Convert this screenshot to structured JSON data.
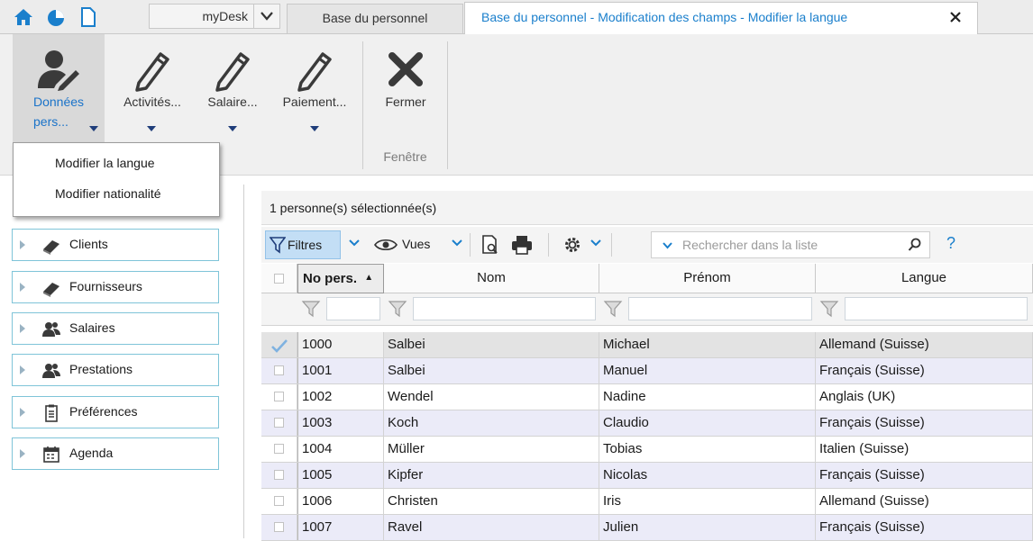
{
  "tabbar": {
    "mydesk": "myDesk",
    "tabs": [
      {
        "label": "Base du personnel"
      },
      {
        "label": "Base du personnel - Modification des champs - Modifier la langue"
      }
    ]
  },
  "ribbon": {
    "buttons": [
      {
        "label_line1": "Données",
        "label_line2": "pers...",
        "icon": "person-edit-icon"
      },
      {
        "label": "Activités...",
        "icon": "pencil-icon"
      },
      {
        "label": "Salaire...",
        "icon": "pencil-icon"
      },
      {
        "label": "Paiement...",
        "icon": "pencil-icon"
      },
      {
        "label": "Fermer",
        "icon": "close-x-icon"
      }
    ],
    "group_fenetre": "Fenêtre"
  },
  "dropdown": {
    "items": [
      "Modifier la langue",
      "Modifier nationalité"
    ]
  },
  "sidebar": {
    "items": [
      {
        "label": "Clients",
        "icon": "book-icon"
      },
      {
        "label": "Fournisseurs",
        "icon": "book-icon"
      },
      {
        "label": "Salaires",
        "icon": "people-icon"
      },
      {
        "label": "Prestations",
        "icon": "people-icon"
      },
      {
        "label": "Préférences",
        "icon": "clipboard-icon"
      },
      {
        "label": "Agenda",
        "icon": "calendar-icon"
      }
    ]
  },
  "main": {
    "selection_count": "1 personne(s) sélectionnée(s)",
    "toolbar": {
      "filtres": "Filtres",
      "vues": "Vues",
      "search_placeholder": "Rechercher dans la liste",
      "help": "?"
    },
    "columns": [
      "No pers.",
      "Nom",
      "Prénom",
      "Langue"
    ],
    "rows": [
      {
        "no": "1000",
        "nom": "Salbei",
        "prenom": "Michael",
        "langue": "Allemand (Suisse)",
        "checked": true
      },
      {
        "no": "1001",
        "nom": "Salbei",
        "prenom": "Manuel",
        "langue": "Français (Suisse)",
        "checked": false
      },
      {
        "no": "1002",
        "nom": "Wendel",
        "prenom": "Nadine",
        "langue": "Anglais (UK)",
        "checked": false
      },
      {
        "no": "1003",
        "nom": "Koch",
        "prenom": "Claudio",
        "langue": "Français (Suisse)",
        "checked": false
      },
      {
        "no": "1004",
        "nom": "Müller",
        "prenom": "Tobias",
        "langue": "Italien (Suisse)",
        "checked": false
      },
      {
        "no": "1005",
        "nom": "Kipfer",
        "prenom": "Nicolas",
        "langue": "Français (Suisse)",
        "checked": false
      },
      {
        "no": "1006",
        "nom": "Christen",
        "prenom": "Iris",
        "langue": "Allemand (Suisse)",
        "checked": false
      },
      {
        "no": "1007",
        "nom": "Ravel",
        "prenom": "Julien",
        "langue": "Français (Suisse)",
        "checked": false
      }
    ]
  },
  "colors": {
    "accent": "#1a7fcc",
    "row_alt": "#ebebf8",
    "row_selected": "#e3e3e3",
    "sidebar_border": "#7fc4d8"
  }
}
